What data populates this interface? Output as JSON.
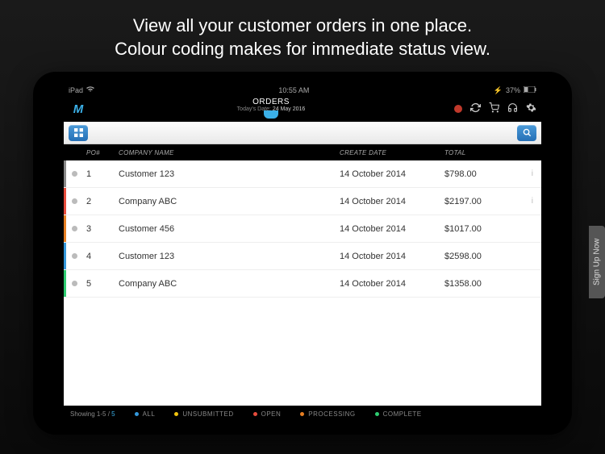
{
  "marketing": {
    "text": "View all your customer orders in one place.\nColour coding makes for immediate status view."
  },
  "ios": {
    "device": "iPad",
    "time": "10:55 AM",
    "battery": "37%"
  },
  "header": {
    "title": "ORDERS",
    "subtitle_label": "Today's Date:",
    "subtitle_date": "24 May 2016"
  },
  "table": {
    "columns": {
      "po": "PO#",
      "company": "COMPANY NAME",
      "date": "CREATE DATE",
      "total": "TOTAL"
    },
    "rows": [
      {
        "po": "1",
        "company": "Customer 123",
        "date": "14 October 2014",
        "total": "$798.00",
        "stripe": "#888888"
      },
      {
        "po": "2",
        "company": "Company ABC",
        "date": "14 October 2014",
        "total": "$2197.00",
        "stripe": "#e74c3c"
      },
      {
        "po": "3",
        "company": "Customer 456",
        "date": "14 October 2014",
        "total": "$1017.00",
        "stripe": "#e67e22"
      },
      {
        "po": "4",
        "company": "Customer 123",
        "date": "14 October 2014",
        "total": "$2598.00",
        "stripe": "#3498db"
      },
      {
        "po": "5",
        "company": "Company ABC",
        "date": "14 October 2014",
        "total": "$1358.00",
        "stripe": "#2ecc71"
      }
    ]
  },
  "footer": {
    "showing_prefix": "Showing 1-5 / ",
    "showing_total": "5",
    "legend": [
      {
        "label": "ALL",
        "color": "#3498db"
      },
      {
        "label": "UNSUBMITTED",
        "color": "#f1c40f"
      },
      {
        "label": "OPEN",
        "color": "#e74c3c"
      },
      {
        "label": "PROCESSING",
        "color": "#e67e22"
      },
      {
        "label": "COMPLETE",
        "color": "#2ecc71"
      }
    ]
  },
  "signup": {
    "label": "Sign Up Now"
  }
}
